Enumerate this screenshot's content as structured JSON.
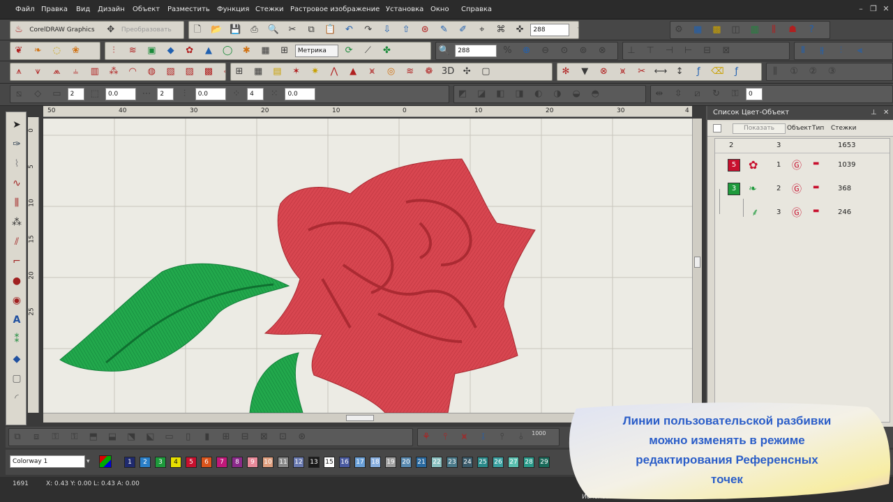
{
  "menu": [
    "Файл",
    "Правка",
    "Вид",
    "Дизайн",
    "Объект",
    "Разместить",
    "Функция",
    "Стежки",
    "Растровое изображение",
    "Установка",
    "Окно",
    "Справка"
  ],
  "toolbar": {
    "corel_button": "CorelDRAW Graphics",
    "transform_button": "Преобразовать",
    "zoom_value_1": "288",
    "zoom_value_2": "288",
    "units_select": "Метрика",
    "spin_values": [
      "2",
      "0.0",
      "2",
      "0.0",
      "4",
      "0.0",
      "0"
    ]
  },
  "ruler_top_labels": [
    "50",
    "40",
    "30",
    "20",
    "10",
    "0",
    "10",
    "20",
    "30",
    "4"
  ],
  "ruler_left_labels": [
    "0",
    "5",
    "10",
    "15",
    "20",
    "25"
  ],
  "panel": {
    "title": "Список Цвет-Объект",
    "show_button": "Показать",
    "columns": [
      "Объект",
      "Тип",
      "Стежки"
    ],
    "summary": {
      "colors": "2",
      "objects": "3",
      "stitches": "1653"
    },
    "groups": [
      {
        "color_index": "5",
        "color": "#c8102e",
        "rows": [
          {
            "num": "1",
            "stitches": "1039"
          }
        ]
      },
      {
        "color_index": "3",
        "color": "#1e9a3c",
        "rows": [
          {
            "num": "2",
            "stitches": "368"
          },
          {
            "num": "3",
            "stitches": "246"
          }
        ]
      }
    ]
  },
  "bottom": {
    "colorway_select": "Colorway 1",
    "stitch_count_label": "1000",
    "color_chips": [
      {
        "n": "1",
        "c": "#1f2a6e"
      },
      {
        "n": "2",
        "c": "#2a7fc8"
      },
      {
        "n": "3",
        "c": "#1e9a3c"
      },
      {
        "n": "4",
        "c": "#e8e000"
      },
      {
        "n": "5",
        "c": "#c8102e"
      },
      {
        "n": "6",
        "c": "#d9541c"
      },
      {
        "n": "7",
        "c": "#c0187a"
      },
      {
        "n": "8",
        "c": "#8a2a8a"
      },
      {
        "n": "9",
        "c": "#e88a9a"
      },
      {
        "n": "10",
        "c": "#e0a080"
      },
      {
        "n": "11",
        "c": "#8a8a8a"
      },
      {
        "n": "12",
        "c": "#6a7ab0"
      },
      {
        "n": "13",
        "c": "#1a1a1a"
      },
      {
        "n": "15",
        "c": "#ffffff"
      },
      {
        "n": "16",
        "c": "#4a5aa0"
      },
      {
        "n": "17",
        "c": "#6aa0d8"
      },
      {
        "n": "18",
        "c": "#8ab0e0"
      },
      {
        "n": "19",
        "c": "#a0a0a0"
      },
      {
        "n": "20",
        "c": "#5a8ab0"
      },
      {
        "n": "21",
        "c": "#2a6aa0"
      },
      {
        "n": "22",
        "c": "#8ac0c0"
      },
      {
        "n": "23",
        "c": "#4a7a8a"
      },
      {
        "n": "24",
        "c": "#3a5a6a"
      },
      {
        "n": "25",
        "c": "#2a8a8a"
      },
      {
        "n": "26",
        "c": "#3aa0a0"
      },
      {
        "n": "27",
        "c": "#5ac0b0"
      },
      {
        "n": "28",
        "c": "#2a9a8a"
      },
      {
        "n": "29",
        "c": "#1a6a5a"
      }
    ]
  },
  "status": {
    "stitch_count": "1691",
    "coords": "X: 0.43 Y: 0.00 L: 0.43 A: 0.00",
    "bottom_note": "Использован"
  },
  "caption": {
    "lines": [
      "Линии пользовательской разбивки",
      "можно изменять в режиме",
      "редактирования Референсных",
      "точек"
    ]
  },
  "colors": {
    "rose": "#d8414a",
    "leaf": "#1fa048",
    "caption_text": "#2a5dc8"
  }
}
